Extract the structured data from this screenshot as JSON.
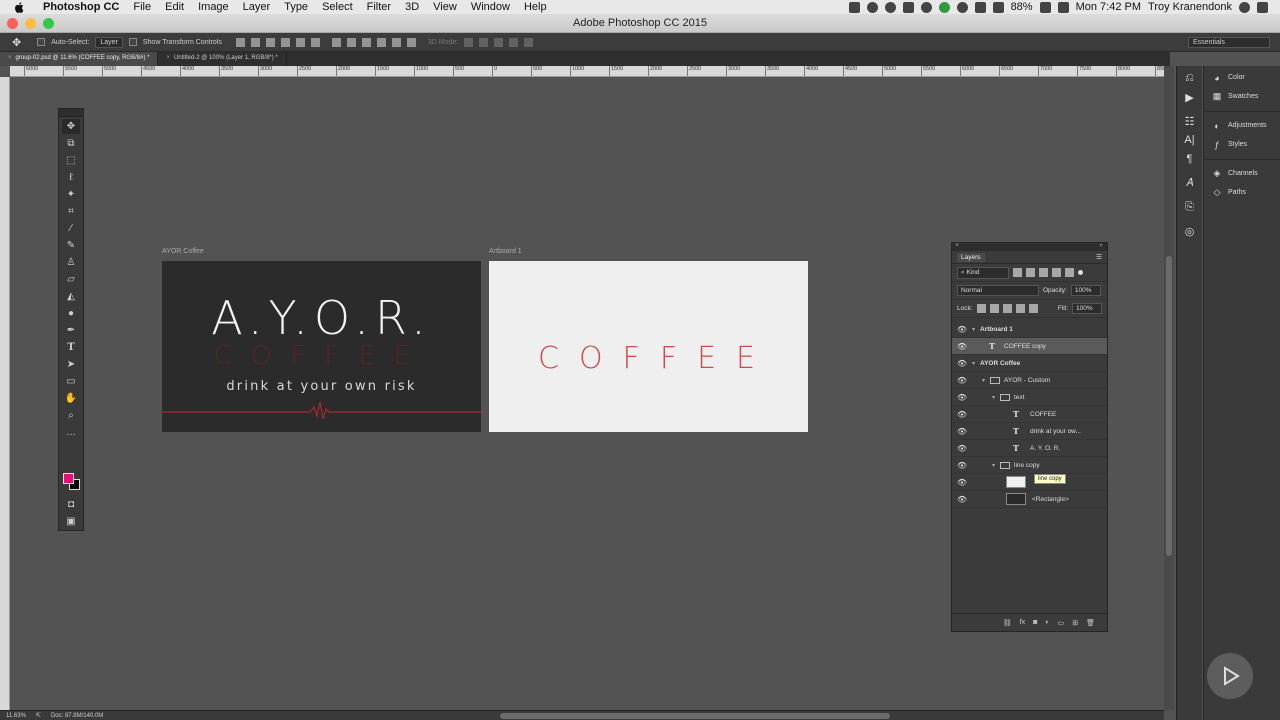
{
  "menubar": {
    "app": "Photoshop CC",
    "items": [
      "File",
      "Edit",
      "Image",
      "Layer",
      "Type",
      "Select",
      "Filter",
      "3D",
      "View",
      "Window",
      "Help"
    ],
    "battery": "88%",
    "clock": "Mon 7:42 PM",
    "user": "Troy Kranendonk"
  },
  "window": {
    "title": "Adobe Photoshop CC 2015"
  },
  "options": {
    "auto_select_label": "Auto-Select:",
    "auto_select_value": "Layer",
    "transform_label": "Show Transform Controls",
    "mode_3d": "3D Mode:",
    "workspace": "Essentials"
  },
  "tabs": [
    {
      "label": "group-02.psd @ 11.6% (COFFEE copy, RGB/8#) *"
    },
    {
      "label": "Untitled-2 @ 100% (Layer 1, RGB/8*) *"
    }
  ],
  "ruler": {
    "ticks": [
      "6000",
      "5500",
      "5000",
      "4500",
      "4000",
      "3500",
      "3000",
      "2500",
      "2000",
      "1500",
      "1000",
      "500",
      "0",
      "500",
      "1000",
      "1500",
      "2000",
      "2500",
      "3000",
      "3500",
      "4000",
      "4500",
      "5000",
      "5500",
      "6000",
      "6500",
      "7000",
      "7500",
      "8000",
      "8500"
    ]
  },
  "artboards": {
    "dark": {
      "label": "AYOR Coffee",
      "title": "A.Y.O.R.",
      "subtitle": "COFFEE",
      "tagline": "drink at your own risk"
    },
    "light": {
      "label": "Artboard 1",
      "title": "COFFEE"
    }
  },
  "dock": {
    "items": [
      {
        "label": "Color",
        "icon": "color-wheel-icon"
      },
      {
        "label": "Swatches",
        "icon": "swatches-grid-icon"
      },
      {
        "label": "Adjustments",
        "icon": "adjustments-icon"
      },
      {
        "label": "Styles",
        "icon": "styles-icon"
      },
      {
        "label": "Channels",
        "icon": "channels-icon"
      },
      {
        "label": "Paths",
        "icon": "paths-icon"
      }
    ]
  },
  "layers_panel": {
    "tab": "Layers",
    "filter": "Kind",
    "blend": "Normal",
    "opacity_label": "Opacity:",
    "opacity": "100%",
    "lock_label": "Lock:",
    "fill_label": "Fill:",
    "fill": "100%",
    "tooltip": "line copy",
    "layers": [
      {
        "name": "Artboard 1",
        "kind": "artboard",
        "indent": 0
      },
      {
        "name": "COFFEE copy",
        "kind": "text",
        "indent": 1,
        "selected": true
      },
      {
        "name": "AYOR Coffee",
        "kind": "artboard",
        "indent": 0
      },
      {
        "name": "AYOR - Custom",
        "kind": "group",
        "indent": 1
      },
      {
        "name": "text",
        "kind": "group",
        "indent": 2
      },
      {
        "name": "COFFEE",
        "kind": "text",
        "indent": 3
      },
      {
        "name": "drink at your ow...",
        "kind": "text",
        "indent": 3
      },
      {
        "name": "A. Y. O. R.",
        "kind": "text",
        "indent": 3
      },
      {
        "name": "line copy",
        "kind": "group",
        "indent": 2
      },
      {
        "name": "",
        "kind": "shape-white",
        "indent": 3
      },
      {
        "name": "<Rectangle>",
        "kind": "shape-dark",
        "indent": 3
      }
    ]
  },
  "status": {
    "zoom": "11.63%",
    "doc": "Doc: 87.8M/140.0M"
  },
  "colors": {
    "foreground": "#e0127a",
    "background": "#000000",
    "canvas": "#535353",
    "accent_red": "#cf4a4a"
  }
}
